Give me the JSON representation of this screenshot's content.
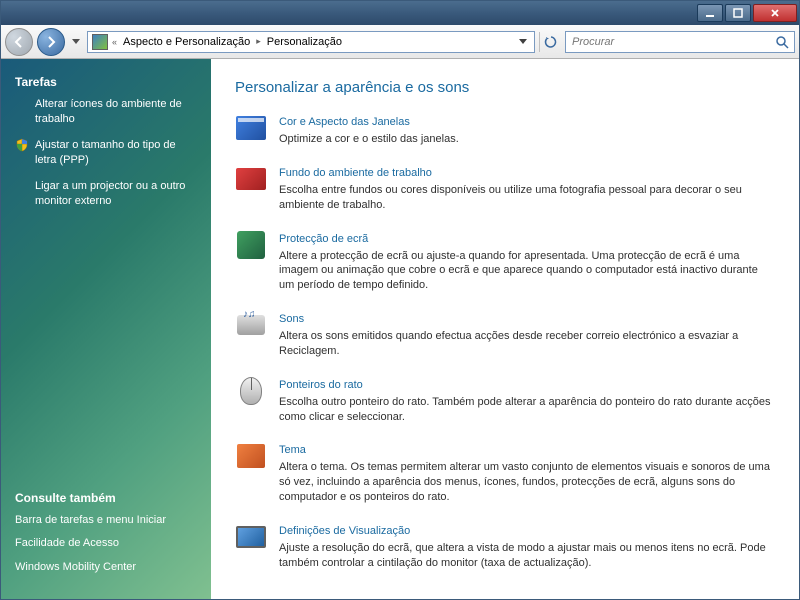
{
  "breadcrumb": {
    "prefix": "«",
    "parent": "Aspecto e Personalização",
    "current": "Personalização"
  },
  "search": {
    "placeholder": "Procurar"
  },
  "sidebar": {
    "tasks_heading": "Tarefas",
    "links": [
      {
        "label": "Alterar ícones do ambiente de trabalho",
        "shield": false
      },
      {
        "label": "Ajustar o tamanho do tipo de letra (PPP)",
        "shield": true
      },
      {
        "label": "Ligar a um projector ou a outro monitor externo",
        "shield": false
      }
    ],
    "seealso_heading": "Consulte também",
    "seealso": [
      {
        "label": "Barra de tarefas e menu Iniciar"
      },
      {
        "label": "Facilidade de Acesso"
      },
      {
        "label": "Windows Mobility Center"
      }
    ]
  },
  "main": {
    "title": "Personalizar a aparência e os sons",
    "items": [
      {
        "link": "Cor e Aspecto das Janelas",
        "desc": "Optimize a cor e o estilo das janelas.",
        "icon": "ico-window",
        "name": "window-color-icon"
      },
      {
        "link": "Fundo do ambiente de trabalho",
        "desc": "Escolha entre fundos ou cores disponíveis ou utilize uma fotografia pessoal para decorar o seu ambiente de trabalho.",
        "icon": "ico-desktop",
        "name": "desktop-background-icon"
      },
      {
        "link": "Protecção de ecrã",
        "desc": "Altere a protecção de ecrã ou ajuste-a quando for apresentada. Uma protecção de ecrã é uma imagem ou animação que cobre o ecrã e que aparece quando o computador está inactivo durante um período de tempo definido.",
        "icon": "ico-screensaver",
        "name": "screensaver-icon"
      },
      {
        "link": "Sons",
        "desc": "Altera os sons emitidos quando efectua acções desde receber correio electrónico a esvaziar a Reciclagem.",
        "icon": "ico-sounds",
        "name": "sounds-icon"
      },
      {
        "link": "Ponteiros do rato",
        "desc": "Escolha outro ponteiro do rato. Também pode alterar a aparência do ponteiro do rato durante acções como clicar e seleccionar.",
        "icon": "ico-mouse",
        "name": "mouse-pointers-icon"
      },
      {
        "link": "Tema",
        "desc": "Altera o tema. Os temas permitem alterar um vasto conjunto de elementos visuais e sonoros de uma só vez, incluindo a aparência dos menus, ícones, fundos, protecções de ecrã, alguns sons do computador e os ponteiros do rato.",
        "icon": "ico-theme",
        "name": "theme-icon"
      },
      {
        "link": "Definições de Visualização",
        "desc": "Ajuste a resolução do ecrã, que altera a vista de modo a ajustar mais ou menos itens no ecrã. Pode também controlar a cintilação do monitor (taxa de actualização).",
        "icon": "ico-display",
        "name": "display-settings-icon"
      }
    ]
  }
}
